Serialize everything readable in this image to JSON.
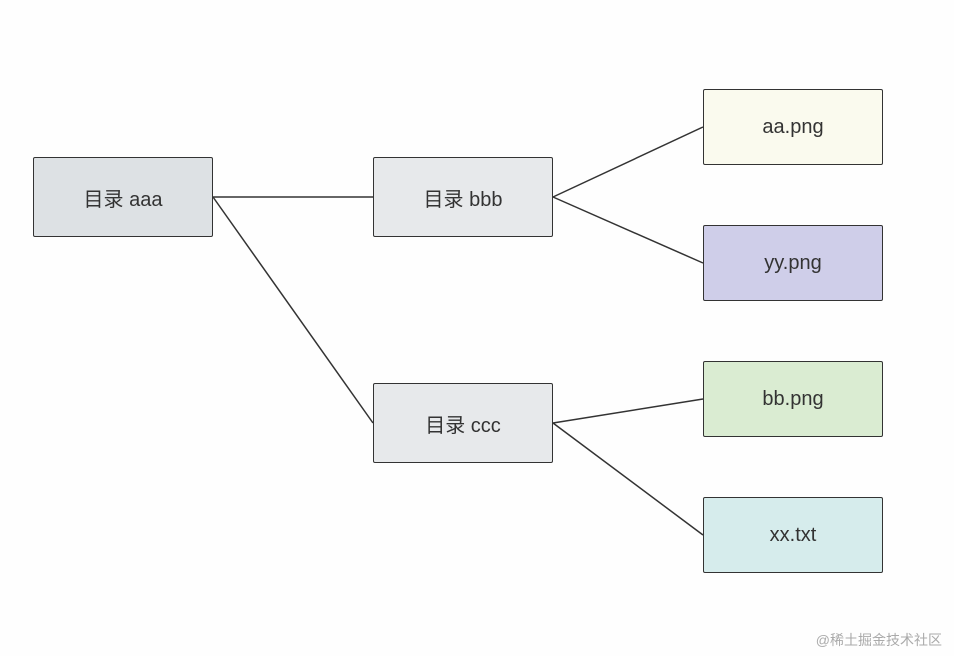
{
  "nodes": {
    "aaa": {
      "label": "目录 aaa",
      "bg": "#dde1e4"
    },
    "bbb": {
      "label": "目录 bbb",
      "bg": "#e7e9eb"
    },
    "ccc": {
      "label": "目录 ccc",
      "bg": "#e7e9eb"
    },
    "aa_png": {
      "label": "aa.png",
      "bg": "#fafaee"
    },
    "yy_png": {
      "label": "yy.png",
      "bg": "#cfcee9"
    },
    "bb_png": {
      "label": "bb.png",
      "bg": "#daecd2"
    },
    "xx_txt": {
      "label": "xx.txt",
      "bg": "#d6ecec"
    }
  },
  "watermark": "@稀土掘金技术社区"
}
